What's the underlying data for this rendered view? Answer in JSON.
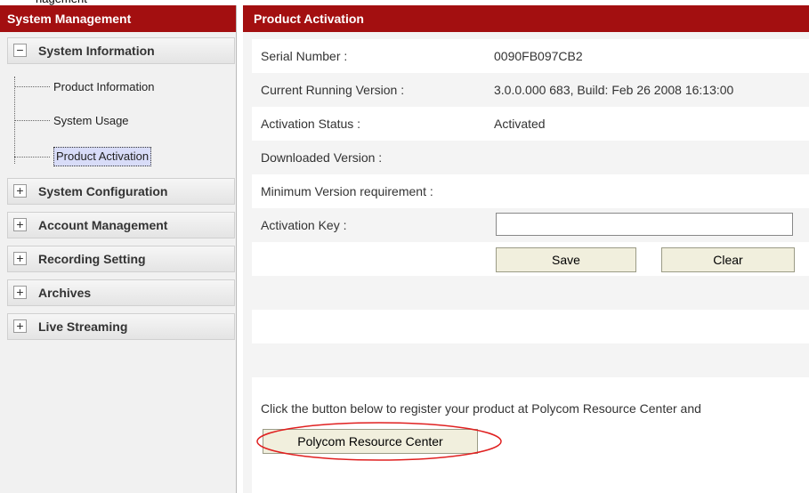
{
  "top_strip_text": "nagement",
  "sidebar": {
    "header": "System Management",
    "groups": [
      {
        "label": "System Information",
        "toggle": "−"
      },
      {
        "label": "System Configuration",
        "toggle": "+"
      },
      {
        "label": "Account Management",
        "toggle": "+"
      },
      {
        "label": "Recording Setting",
        "toggle": "+"
      },
      {
        "label": "Archives",
        "toggle": "+"
      },
      {
        "label": "Live Streaming",
        "toggle": "+"
      }
    ],
    "subitems": [
      {
        "label": "Product Information"
      },
      {
        "label": "System Usage"
      },
      {
        "label": "Product Activation"
      }
    ]
  },
  "main": {
    "header": "Product Activation",
    "fields": {
      "serial_label": "Serial Number :",
      "serial_value": "0090FB097CB2",
      "version_label": "Current Running Version :",
      "version_value": "3.0.0.000 683, Build: Feb 26 2008 16:13:00",
      "status_label": "Activation Status :",
      "status_value": "Activated",
      "downloaded_label": "Downloaded Version :",
      "minimum_label": "Minimum Version requirement :",
      "key_label": "Activation Key :",
      "key_value": ""
    },
    "buttons": {
      "save": "Save",
      "clear": "Clear",
      "resource_center": "Polycom Resource Center"
    },
    "register_text": "Click the button below to register your product at Polycom Resource Center and"
  },
  "colors": {
    "header_red": "#a30f10",
    "annotation_red": "#e02020",
    "selected_bg": "#d8dcf8"
  }
}
